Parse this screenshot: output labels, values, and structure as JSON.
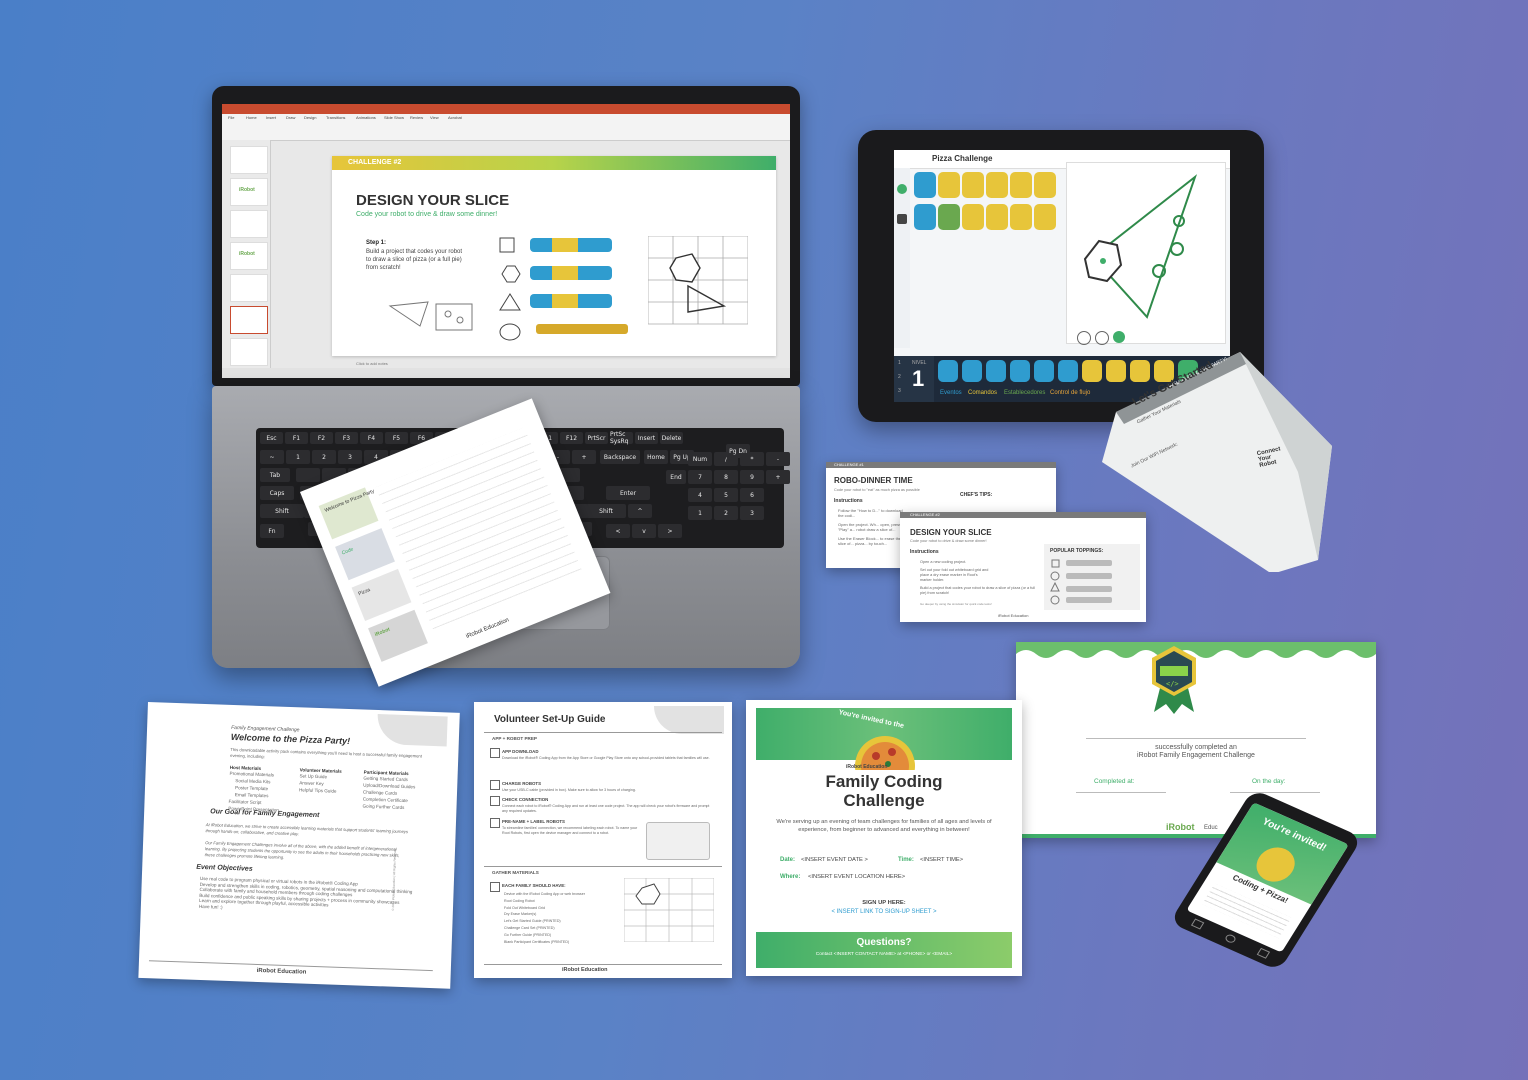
{
  "laptop": {
    "ppt": {
      "tabs": [
        "File",
        "Home",
        "Insert",
        "Draw",
        "Design",
        "Transitions",
        "Animations",
        "Slide Show",
        "Review",
        "View",
        "Acrobat"
      ],
      "slide": {
        "challenge_tag": "CHALLENGE #2",
        "title": "DESIGN YOUR SLICE",
        "subtitle": "Code your robot to drive & draw some dinner!",
        "step_label": "Step 1:",
        "step_text": "Build a project that codes your robot to draw a slice of pizza (or a full pie) from scratch!"
      },
      "thumb_brand": "iRobot",
      "notes_placeholder": "Click to add notes"
    },
    "keys": {
      "row1": [
        "Esc",
        "F1",
        "F2",
        "F3",
        "F4",
        "F5",
        "F6",
        "F7",
        "F8",
        "F9",
        "F10",
        "F11",
        "F12",
        "PrtScr",
        "PrtSc SysRq",
        "Insert",
        "Delete"
      ],
      "row2": [
        "~",
        "1",
        "2",
        "3",
        "4",
        "5",
        "6",
        "7",
        "8",
        "9",
        "0",
        "-",
        "+",
        "Backspace",
        "Home",
        "Pg Up"
      ],
      "numpad": [
        "Num",
        "/",
        "*",
        "-",
        "7",
        "8",
        "9",
        "+",
        "4",
        "5",
        "6",
        "1",
        "2",
        "3",
        "0",
        ".",
        "Enter"
      ],
      "other": [
        "Tab",
        "Caps",
        "Shift",
        "Fn",
        "Enter",
        "Shift",
        "^",
        "<",
        "v",
        ">",
        "Pg Dn",
        "End"
      ]
    }
  },
  "handout_on_laptop": {
    "brand": "iRobot Education",
    "heading_lines": [
      "Welcome to Pizza Party",
      "Code",
      "Pizza",
      "iRobot"
    ]
  },
  "tablet": {
    "project_title": "Pizza Challenge",
    "level_label": "NIVEL",
    "level_num": "1",
    "rows": [
      "1",
      "2",
      "3"
    ],
    "bottom_tabs": [
      "Eventos",
      "Comandos",
      "Establecedores",
      "Control de flujo"
    ]
  },
  "tent_card": {
    "top_banner": "WELCOME TO THE PARTY!",
    "title": "Let's Get Started",
    "subtitle": "Gather Your Materials",
    "wifi_label": "Join Our WiFi Network:",
    "connect_title": "Connect Your Robot"
  },
  "card_robo": {
    "tag": "CHALLENGE #1",
    "title": "ROBO-DINNER TIME",
    "subtitle": "Code your robot to \"eat\" as much pizza as possible",
    "instructions": "Instructions",
    "tips": "CHEF'S TIPS:",
    "steps": [
      "Follow the \"How to D...\" to download the codi...",
      "Open the project. Wh... open, press \"Play\" a... robot draw a slice of...",
      "Use the Eraser Block... to erase the slice of... pizza... by touch..."
    ]
  },
  "card_slice": {
    "tag": "CHALLENGE #2",
    "title": "DESIGN YOUR SLICE",
    "subtitle": "Code your robot to drive & draw some dinner!",
    "instructions": "Instructions",
    "toppings": "POPULAR TOPPINGS:",
    "steps": [
      "Open a new coding project.",
      "Set out your fold out whiteboard grid and place a dry erase marker in Root's marker holder.",
      "Build a project that codes your robot to draw a slice of pizza (or a full pie) from scratch!"
    ],
    "footer_hint": "Go deeper by using the simulator for quick code tests!",
    "brand": "iRobot Education"
  },
  "certificate": {
    "line1": "successfully completed an",
    "line2": "iRobot Family Engagement Challenge",
    "completed_at": "Completed at:",
    "on_the_day": "On the day:",
    "brand": "iRobot",
    "brand_suffix": "Educ"
  },
  "welcome_doc": {
    "kicker": "Family Engagement Challenge",
    "title": "Welcome to the Pizza Party!",
    "intro": "This downloadable activity pack contains everything you'll need to host a successful family engagement evening, including:",
    "host_title": "Host Materials",
    "host_items": [
      "Promotional Materials",
      "Social Media Kits",
      "Poster Template",
      "Email Templates",
      "Facilitator Script",
      "PowerPoint Presentation"
    ],
    "volunteer_title": "Volunteer Materials",
    "volunteer_items": [
      "Set Up Guide",
      "Answer Key",
      "Helpful Tips Guide"
    ],
    "participant_title": "Participant Materials",
    "participant_items": [
      "Getting Started Cards",
      "Upload/Download Guides",
      "Challenge Cards",
      "Completion Certificate",
      "Going Further Cards"
    ],
    "goal_title": "Our Goal for Family Engagement",
    "goal_p1": "At iRobot Education, we strive to create accessible learning materials that support students' learning journeys through hands-on, collaborative, and creative play.",
    "goal_p2": "Our Family Engagement Challenges involve all of the above, with the added benefit of intergenerational learning. By projecting students the opportunity to see the adults in their households practicing new skills, these challenges promote lifelong learning.",
    "objectives_title": "Event Objectives",
    "objectives": [
      "Use real code to program physical or virtual robots in the iRobot® Coding App",
      "Develop and strengthen skills in coding, robotics, geometry, spatial reasoning and computational thinking",
      "Collaborate with family and household members through coding challenges",
      "Build confidence and public speaking skills by sharing projects + process in community showcases",
      "Learn and explore together through playful, accessible activities",
      "Have fun! :)"
    ],
    "brand": "iRobot Education",
    "copyright": "© 2021 iRobot Education | All Rights Reserved"
  },
  "volunteer_doc": {
    "title": "Volunteer Set-Up Guide",
    "section1": "APP + ROBOT PREP",
    "items": [
      {
        "title": "APP DOWNLOAD",
        "text": "Download the iRobot® Coding App from the App Store or Google Play Store onto any school-provided tablets that families will use."
      },
      {
        "title": "CHARGE ROBOTS",
        "text": "Use your USB-C cable (provided in box). Make sure to allow for 3 hours of charging."
      },
      {
        "title": "CHECK CONNECTION",
        "text": "Connect each robot to iRobot® Coding App and run at least one code project. The app will check your robot's firmware and prompt any required updates."
      },
      {
        "title": "PRE-NAME + LABEL ROBOTS",
        "text": "To streamline families' connection, we recommend labeling each robot. To name your Root Robots, first open the device manager and connect to a robot."
      }
    ],
    "section2": "GATHER MATERIALS",
    "family_title": "EACH FAMILY SHOULD HAVE:",
    "family_items": [
      "Device with the iRobot Coding App or web browser",
      "Root Coding Robot",
      "Fold Out Whiteboard Grid",
      "Dry Erase Marker(s)",
      "Let's Get Started Guide (PRINTED)",
      "Challenge Card Set (PRINTED)",
      "Go Further Guide (PRINTED)",
      "Blank Participant Certificates (PRINTED)"
    ],
    "brand": "iRobot Education"
  },
  "flyer": {
    "invite_arc": "You're invited to the",
    "brand": "iRobot Education",
    "title_line1": "Family Coding",
    "title_line2": "Challenge",
    "body": "We're serving up an evening of team challenges for families of all ages and levels of experience, from beginner to advanced and everything in between!",
    "date_label": "Date:",
    "date_value": "<INSERT EVENT DATE >",
    "time_label": "Time:",
    "time_value": "<INSERT TIME>",
    "where_label": "Where:",
    "where_value": "<INSERT EVENT LOCATION HERE>",
    "signup_label": "SIGN UP HERE:",
    "signup_value": "< INSERT LINK TO SIGN-UP SHEET >",
    "questions": "Questions?",
    "contact": "Contact <INSERT CONTACT NAME> at <PHONE> or <EMAIL>"
  },
  "phone": {
    "headline": "You're invited!",
    "sub": "Coding + Pizza!"
  },
  "colors": {
    "accent_green": "#3fae6a",
    "accent_yellow": "#e7c53a",
    "accent_blue": "#2f9ccf",
    "brand_green": "#6aa84f"
  }
}
